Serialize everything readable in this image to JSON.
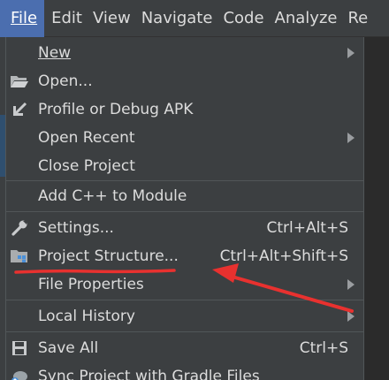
{
  "menubar": {
    "items": [
      {
        "label": "File",
        "mnemonic_index": 0,
        "active": true
      },
      {
        "label": "Edit",
        "mnemonic_index": 0
      },
      {
        "label": "View",
        "mnemonic_index": 0
      },
      {
        "label": "Navigate",
        "mnemonic_index": 0
      },
      {
        "label": "Code",
        "mnemonic_index": 0
      },
      {
        "label": "Analyze",
        "mnemonic_index": -1
      },
      {
        "label": "Re",
        "mnemonic_index": 0
      }
    ]
  },
  "file_menu": {
    "new": {
      "label": "New",
      "has_submenu": true
    },
    "open": {
      "label": "Open...",
      "icon": "folder-open-icon"
    },
    "profile_debug": {
      "label": "Profile or Debug APK",
      "icon": "import-arrow-icon"
    },
    "open_recent": {
      "label": "Open Recent",
      "has_submenu": true
    },
    "close_project": {
      "label": "Close Project"
    },
    "add_cpp": {
      "label": "Add C++ to Module"
    },
    "settings": {
      "label": "Settings...",
      "shortcut": "Ctrl+Alt+S",
      "icon": "wrench-icon"
    },
    "project_structure": {
      "label": "Project Structure...",
      "shortcut": "Ctrl+Alt+Shift+S",
      "icon": "project-structure-icon"
    },
    "file_properties": {
      "label": "File Properties",
      "has_submenu": true
    },
    "local_history": {
      "label": "Local History",
      "has_submenu": true
    },
    "save_all": {
      "label": "Save All",
      "shortcut": "Ctrl+S",
      "icon": "floppy-disk-icon"
    },
    "sync_gradle": {
      "label": "Sync Project with Gradle Files",
      "icon": "gradle-sync-icon"
    }
  },
  "colors": {
    "menu_bg": "#3c3f41",
    "active_menu": "#4b6eaf",
    "text": "#dcdcdc",
    "separator": "#515658",
    "annotation_red": "#e8312f"
  }
}
